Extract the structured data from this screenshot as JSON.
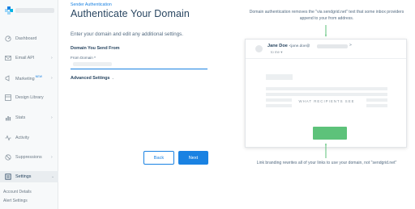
{
  "sidebar": {
    "items": [
      {
        "label": "Dashboard",
        "icon": "dashboard-icon",
        "caret": ""
      },
      {
        "label": "Email API",
        "icon": "email-api-icon",
        "caret": "›"
      },
      {
        "label": "Marketing",
        "badge": "NEW",
        "icon": "marketing-icon",
        "caret": "›"
      },
      {
        "label": "Design Library",
        "icon": "design-library-icon",
        "caret": ""
      },
      {
        "label": "Stats",
        "icon": "stats-icon",
        "caret": "›"
      },
      {
        "label": "Activity",
        "icon": "activity-icon",
        "caret": ""
      },
      {
        "label": "Suppressions",
        "icon": "suppressions-icon",
        "caret": "›"
      },
      {
        "label": "Settings",
        "icon": "settings-icon",
        "caret": "⌄"
      }
    ],
    "sub_items": [
      "Account Details",
      "Alert Settings"
    ]
  },
  "header": {
    "breadcrumb": "Sender Authentication",
    "title": "Authenticate Your Domain"
  },
  "form": {
    "intro": "Enter your domain and edit any additional settings.",
    "section_label": "Domain You Send From",
    "input_label": "From Domain",
    "required_mark": "*",
    "advanced_label": "Advanced Settings",
    "advanced_chevron": "⌄",
    "back_label": "Back",
    "next_label": "Next"
  },
  "illustration": {
    "top_note": "Domain authentication removes the \"via sendgrid.net\" text that some inbox providers append to your from address.",
    "bottom_note": "Link branding rewrites all of your links to use your domain, not \"sendgrid.net\"",
    "sender_name": "Jane Doe",
    "sender_addr_prefix": "<jane.doe@",
    "sender_addr_suffix": ">",
    "to_me": "to me",
    "recipients_text": "WHAT RECIPIENTS SEE"
  },
  "colors": {
    "accent": "#1a82e2",
    "title": "#294661",
    "green": "#5dc27a",
    "arrow": "#5dc27a"
  }
}
